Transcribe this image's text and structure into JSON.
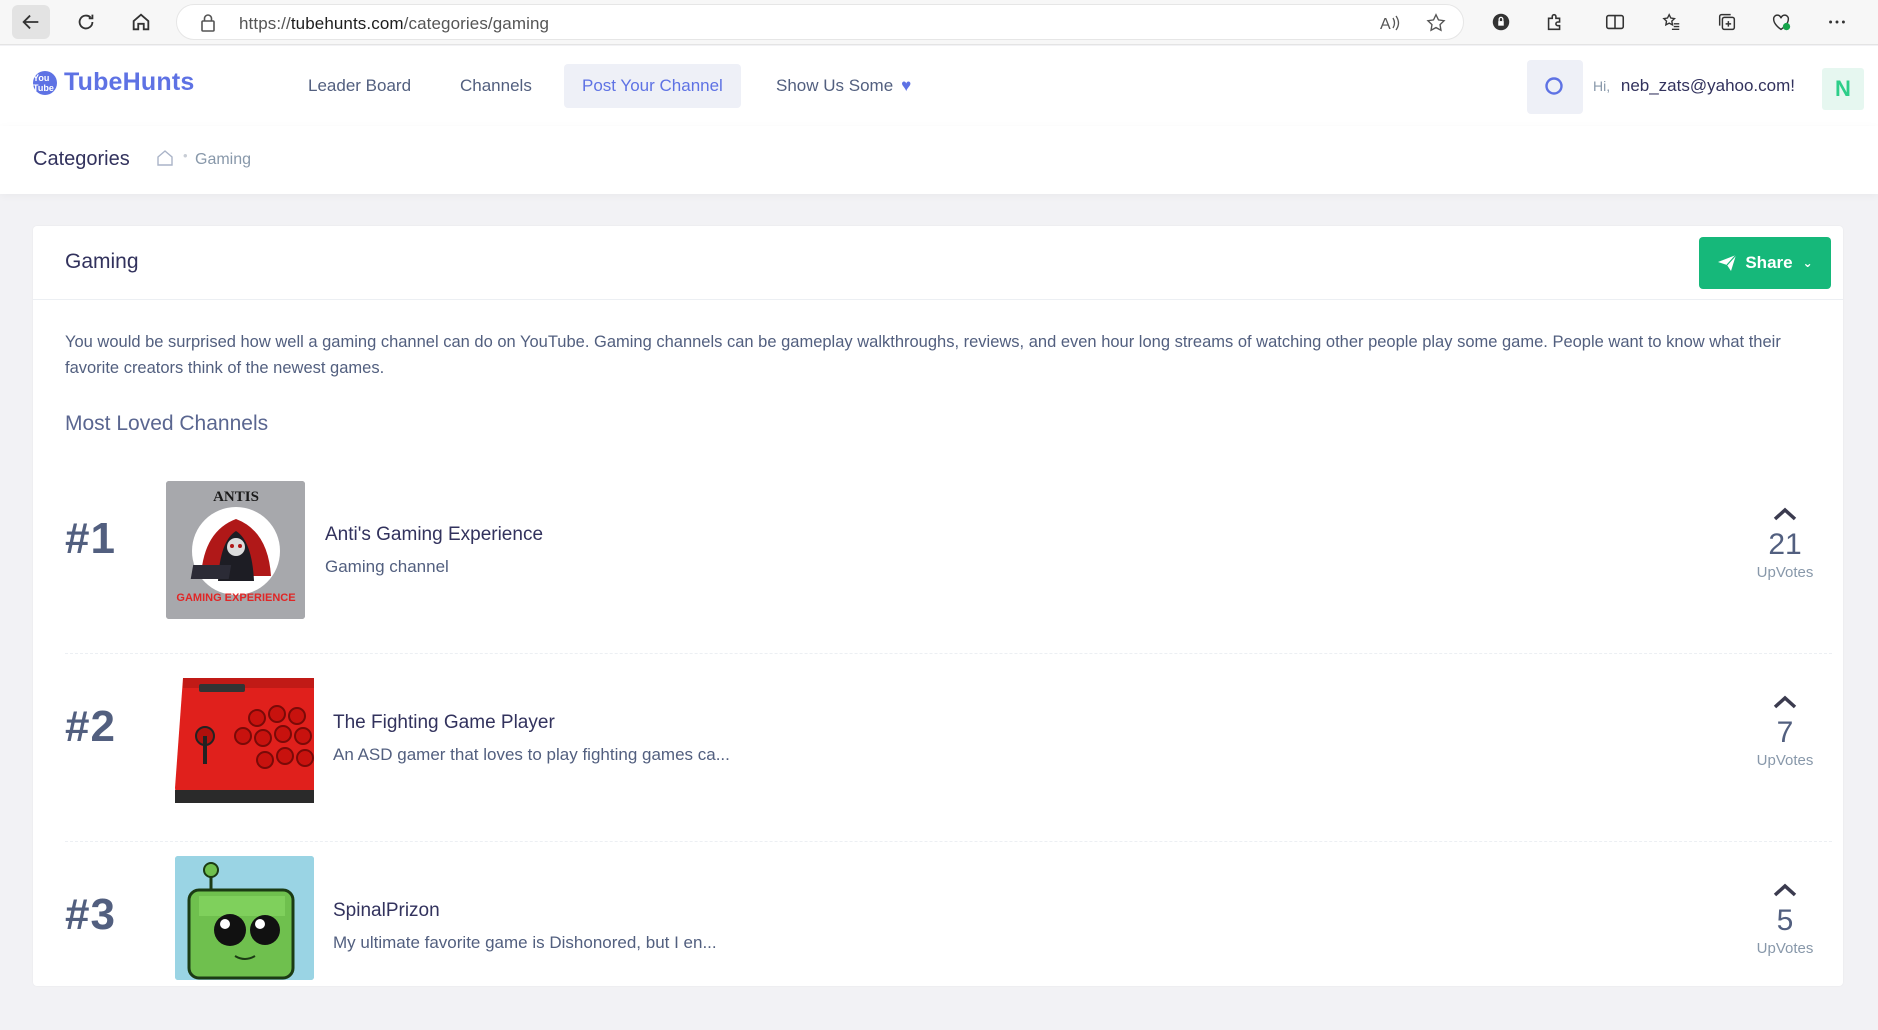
{
  "browser": {
    "url_prefix": "https://",
    "url_domain": "tubehunts.com",
    "url_path": "/categories/gaming"
  },
  "header": {
    "logo_mark": "You Tube",
    "logo_text": "TubeHunts",
    "nav": [
      {
        "label": "Leader Board"
      },
      {
        "label": "Channels"
      },
      {
        "label": "Post Your Channel"
      },
      {
        "label": "Show Us Some"
      }
    ],
    "greeting_prefix": "Hi,",
    "user_email": "neb_zats@yahoo.com!",
    "avatar_letter": "N"
  },
  "breadcrumb": {
    "title": "Categories",
    "current": "Gaming"
  },
  "card": {
    "title": "Gaming",
    "share_label": "Share",
    "description": "You would be surprised how well a gaming channel can do on YouTube. Gaming channels can be gameplay walkthroughs, reviews, and even hour long streams of watching other people play some game. People want to know what their favorite creators think of the newest games.",
    "section_title": "Most Loved Channels",
    "upvotes_label": "UpVotes",
    "channels": [
      {
        "rank": "#1",
        "name": "Anti's Gaming Experience",
        "subtitle": "Gaming channel",
        "upvotes": "21",
        "thumb_text_top": "ANTIS",
        "thumb_text_bottom": "GAMING EXPERIENCE"
      },
      {
        "rank": "#2",
        "name": "The Fighting Game Player",
        "subtitle": "An ASD gamer that loves to play fighting games ca...",
        "upvotes": "7"
      },
      {
        "rank": "#3",
        "name": "SpinalPrizon",
        "subtitle": "My ultimate favorite game is Dishonored, but I en...",
        "upvotes": "5"
      }
    ]
  },
  "colors": {
    "brand": "#5e72e4",
    "share": "#16b87a",
    "avatar": "#2dce89"
  }
}
